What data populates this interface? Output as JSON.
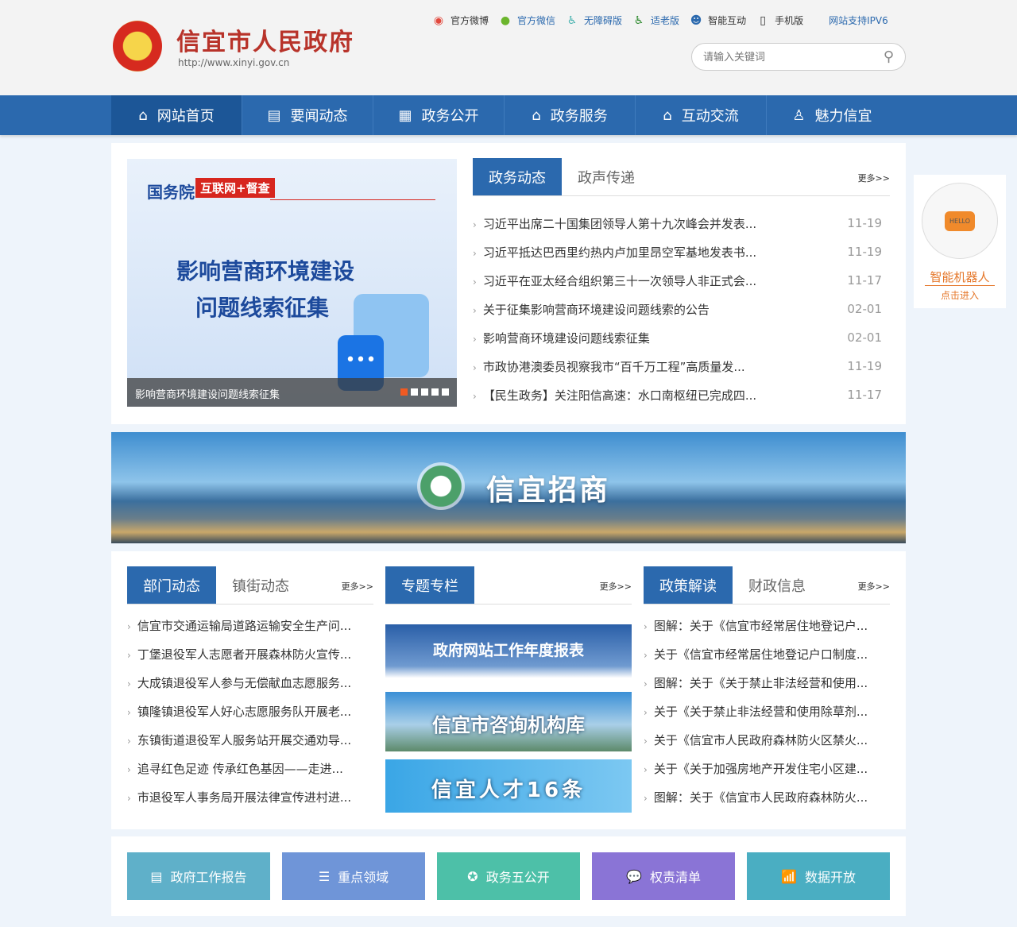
{
  "header": {
    "title": "信宜市人民政府",
    "url": "http://www.xinyi.gov.cn",
    "links": [
      {
        "icon": "weibo-icon",
        "label": "官方微博",
        "color": "#333"
      },
      {
        "icon": "wechat-icon",
        "label": "官方微信",
        "color": "#2b69ae"
      },
      {
        "icon": "accessibility-icon",
        "label": "无障碍版",
        "color": "#2b69ae"
      },
      {
        "icon": "elderly-icon",
        "label": "适老版",
        "color": "#2b69ae"
      },
      {
        "icon": "robot-icon",
        "label": "智能互动",
        "color": "#333"
      },
      {
        "icon": "mobile-icon",
        "label": "手机版",
        "color": "#333"
      },
      {
        "icon": "",
        "label": "网站支持IPV6",
        "color": "#2b69ae"
      }
    ],
    "search_placeholder": "请输入关键词"
  },
  "nav": [
    "网站首页",
    "要闻动态",
    "政务公开",
    "政务服务",
    "互动交流",
    "魅力信宜"
  ],
  "slider": {
    "badge1": "国务院",
    "badge2": "互联网+督查",
    "headline1": "影响营商环境建设",
    "headline2": "问题线索征集",
    "caption": "影响营商环境建设问题线索征集"
  },
  "news": {
    "tabs": [
      "政务动态",
      "政声传递"
    ],
    "more": "更多>>",
    "items": [
      {
        "title": "习近平出席二十国集团领导人第十九次峰会并发表...",
        "date": "11-19"
      },
      {
        "title": "习近平抵达巴西里约热内卢加里昂空军基地发表书...",
        "date": "11-19"
      },
      {
        "title": "习近平在亚太经合组织第三十一次领导人非正式会...",
        "date": "11-17"
      },
      {
        "title": "关于征集影响营商环境建设问题线索的公告",
        "date": "02-01"
      },
      {
        "title": "影响营商环境建设问题线索征集",
        "date": "02-01"
      },
      {
        "title": "市政协港澳委员视察我市“百千万工程”高质量发...",
        "date": "11-19"
      },
      {
        "title": "【民生政务】关注阳信高速：水口南枢纽已完成四...",
        "date": "11-17"
      }
    ]
  },
  "robot": {
    "title": "智能机器人",
    "sub": "点击进入",
    "hello": "HELLO"
  },
  "banner": {
    "title": "信宜招商"
  },
  "dept": {
    "tabs": [
      "部门动态",
      "镇街动态"
    ],
    "more": "更多>>",
    "items": [
      "信宜市交通运输局道路运输安全生产问...",
      "丁堡退役军人志愿者开展森林防火宣传...",
      "大成镇退役军人参与无偿献血志愿服务...",
      "镇隆镇退役军人好心志愿服务队开展老...",
      "东镇街道退役军人服务站开展交通劝导...",
      "追寻红色足迹 传承红色基因——走进...",
      "市退役军人事务局开展法律宣传进村进..."
    ]
  },
  "topics": {
    "tabs": [
      "专题专栏"
    ],
    "more": "更多>>",
    "banners": [
      "政府网站工作年度报表",
      "信宜市咨询机构库",
      "信宜人才16条"
    ]
  },
  "policy": {
    "tabs": [
      "政策解读",
      "财政信息"
    ],
    "more": "更多>>",
    "items": [
      "图解：关于《信宜市经常居住地登记户...",
      "关于《信宜市经常居住地登记户口制度...",
      "图解：关于《关于禁止非法经营和使用...",
      "关于《关于禁止非法经营和使用除草剂...",
      "关于《信宜市人民政府森林防火区禁火...",
      "关于《关于加强房地产开发住宅小区建...",
      "图解：关于《信宜市人民政府森林防火..."
    ]
  },
  "quick": [
    {
      "label": "政府工作报告",
      "color": "#5fb0c9"
    },
    {
      "label": "重点领域",
      "color": "#6f95d8"
    },
    {
      "label": "政务五公开",
      "color": "#4dc0a8"
    },
    {
      "label": "权责清单",
      "color": "#8a74d6"
    },
    {
      "label": "数据开放",
      "color": "#4aaec2"
    }
  ]
}
